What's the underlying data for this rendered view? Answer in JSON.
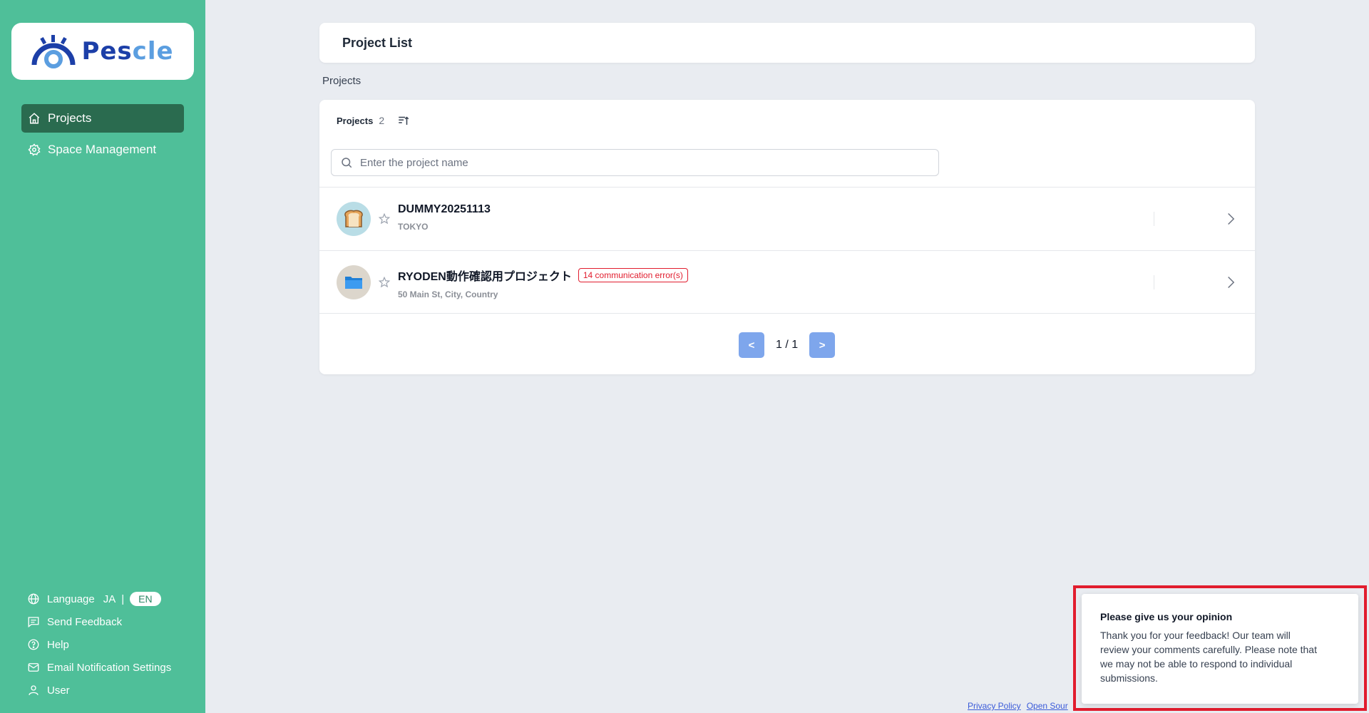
{
  "brand": {
    "name_main": "Pes",
    "name_accent": "cle"
  },
  "sidebar": {
    "nav": [
      {
        "label": "Projects",
        "icon": "home-icon",
        "active": true
      },
      {
        "label": "Space Management",
        "icon": "gear-icon",
        "active": false
      }
    ],
    "bottom": {
      "language_label": "Language",
      "language_ja": "JA",
      "language_sep": "|",
      "language_en": "EN",
      "feedback": "Send Feedback",
      "help": "Help",
      "email_settings": "Email Notification Settings",
      "user": "User"
    }
  },
  "header": {
    "title": "Project List"
  },
  "section": {
    "label": "Projects"
  },
  "list": {
    "label": "Projects",
    "count": "2",
    "search_placeholder": "Enter the project name",
    "projects": [
      {
        "name": "DUMMY20251113",
        "subtitle": "TOKYO",
        "avatar": "bread-icon"
      },
      {
        "name": "RYODEN動作確認用プロジェクト",
        "subtitle": "50 Main St, City, Country",
        "avatar": "folder-icon",
        "badge": "14 communication error(s)"
      }
    ],
    "pager": {
      "prev": "<",
      "page": "1 / 1",
      "next": ">"
    }
  },
  "feedback_popup": {
    "title": "Please give us your opinion",
    "body": "Thank you for your feedback! Our team will review your comments carefully. Please note that we may not be able to respond to individual submissions."
  },
  "footer": {
    "privacy": "Privacy Policy",
    "open_source": "Open Sour"
  },
  "colors": {
    "sidebar": "#4fbf99",
    "active_nav": "#2a6b4f",
    "error": "#e11d2e",
    "pager": "#7ea6ec"
  }
}
